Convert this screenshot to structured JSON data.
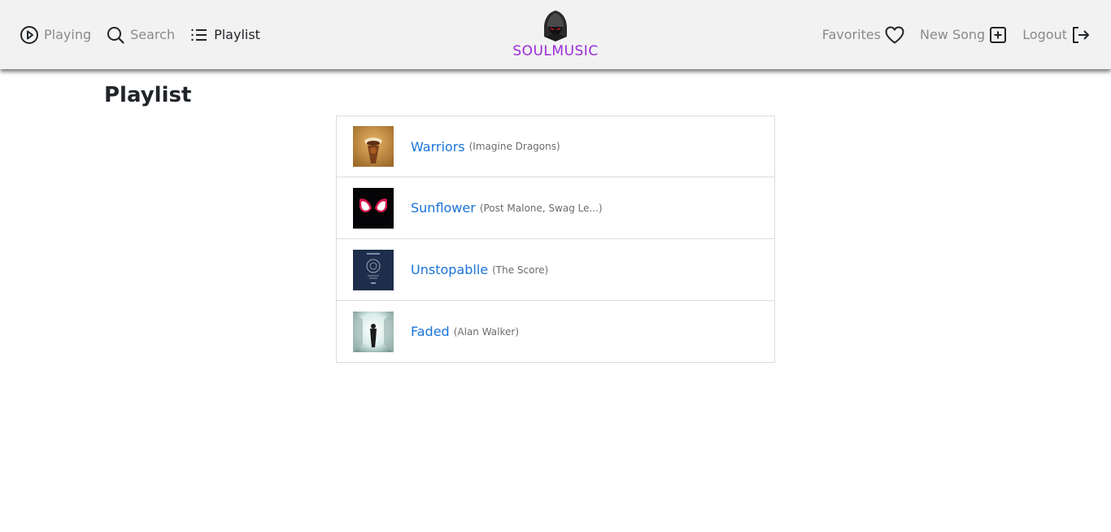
{
  "nav": {
    "left": [
      {
        "label": "Playing",
        "icon": "play-circle-icon"
      },
      {
        "label": "Search",
        "icon": "search-icon"
      },
      {
        "label": "Playlist",
        "icon": "list-icon"
      }
    ],
    "right": [
      {
        "label": "Favorites",
        "icon": "heart-icon"
      },
      {
        "label": "New Song",
        "icon": "plus-square-icon"
      },
      {
        "label": "Logout",
        "icon": "logout-icon"
      }
    ],
    "brand": "SOULMUSIC",
    "brand_color": "#9b2bd6"
  },
  "page": {
    "title": "Playlist"
  },
  "playlist": [
    {
      "title": "Warriors",
      "artist": "(Imagine Dragons)",
      "cover": "warriors-cover"
    },
    {
      "title": "Sunflower",
      "artist": "(Post Malone, Swag Le...)",
      "cover": "sunflower-cover"
    },
    {
      "title": "Unstopablle",
      "artist": "(The Score)",
      "cover": "unstoppable-cover"
    },
    {
      "title": "Faded",
      "artist": "(Alan Walker)",
      "cover": "faded-cover"
    }
  ],
  "colors": {
    "link": "#1a73d9",
    "nav_bg": "#f2f2f2",
    "muted": "#8a8a8a"
  }
}
